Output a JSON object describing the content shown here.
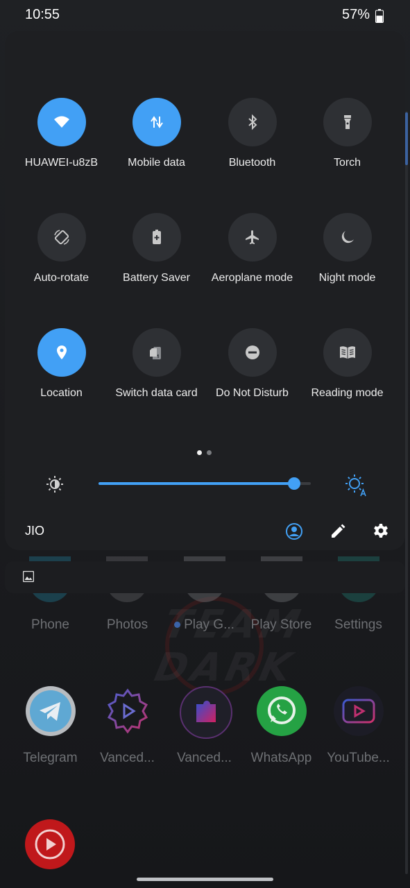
{
  "status_bar": {
    "time": "10:55",
    "battery_percent": "57%",
    "battery_level": 0.57
  },
  "quick_settings": {
    "tiles": [
      {
        "label": "HUAWEI-u8zB",
        "icon": "wifi-icon",
        "active": true
      },
      {
        "label": "Mobile data",
        "icon": "mobile-data-icon",
        "active": true
      },
      {
        "label": "Bluetooth",
        "icon": "bluetooth-icon",
        "active": false
      },
      {
        "label": "Torch",
        "icon": "torch-icon",
        "active": false
      },
      {
        "label": "Auto-rotate",
        "icon": "auto-rotate-icon",
        "active": false
      },
      {
        "label": "Battery Saver",
        "icon": "battery-saver-icon",
        "active": false
      },
      {
        "label": "Aeroplane mode",
        "icon": "airplane-icon",
        "active": false
      },
      {
        "label": "Night mode",
        "icon": "moon-icon",
        "active": false
      },
      {
        "label": "Location",
        "icon": "location-pin-icon",
        "active": true
      },
      {
        "label": "Switch data card",
        "icon": "sim-card-icon",
        "active": false
      },
      {
        "label": "Do Not Disturb",
        "icon": "do-not-disturb-icon",
        "active": false
      },
      {
        "label": "Reading mode",
        "icon": "book-icon",
        "active": false
      }
    ],
    "pager": {
      "pages": 2,
      "current": 1
    },
    "brightness": {
      "level": 0.92
    },
    "carrier": "JIO"
  },
  "home_screen": {
    "row1": [
      {
        "label": "Phone"
      },
      {
        "label": "Photos"
      },
      {
        "label": "Play G..."
      },
      {
        "label": "Play Store"
      },
      {
        "label": "Settings"
      }
    ],
    "row2": [
      {
        "label": "Telegram"
      },
      {
        "label": "Vanced..."
      },
      {
        "label": "Vanced..."
      },
      {
        "label": "WhatsApp"
      },
      {
        "label": "YouTube..."
      }
    ]
  },
  "colors": {
    "accent": "#42a0f5",
    "tile_off": "#2e3034",
    "panel": "#1e1f22",
    "telegram": "#5fa8d3",
    "whatsapp": "#25a244",
    "youtube_music": "#c0181b"
  }
}
